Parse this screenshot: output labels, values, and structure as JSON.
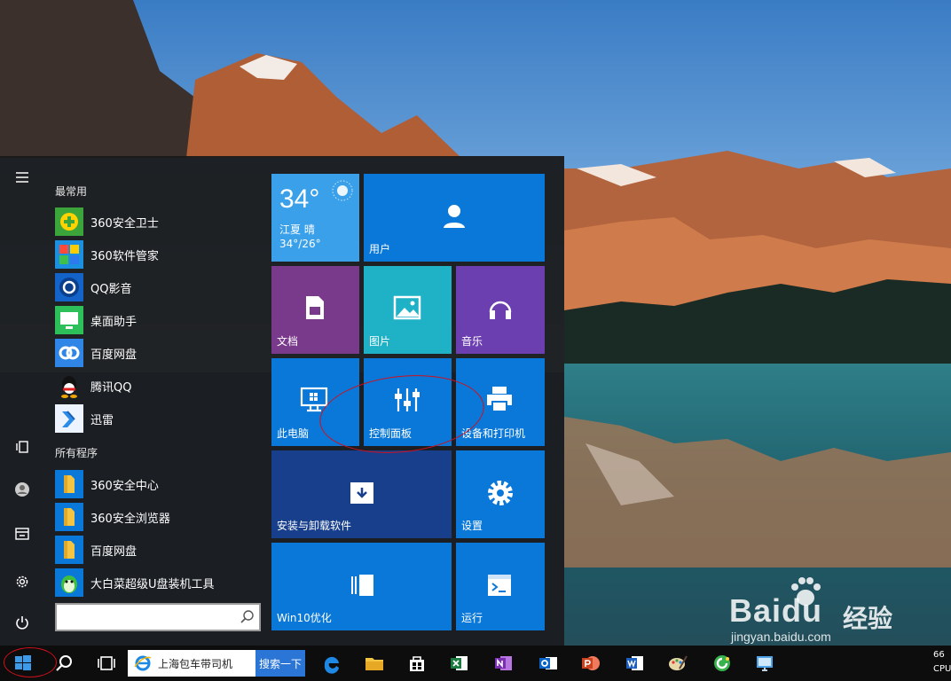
{
  "colors": {
    "tile_blue": "#0a78d8",
    "tile_purple": "#7a3a8c",
    "tile_teal": "#1fb1c6",
    "tile_violet": "#6b3fb0",
    "tile_dark_blue": "#173f8c",
    "start_bg": "#181818",
    "taskbar_bg": "#0d0d0d",
    "annotation_red": "#d0101c"
  },
  "start_menu": {
    "rail": {
      "items": [
        {
          "name": "menu-icon"
        },
        {
          "name": "tablet-mode-icon"
        },
        {
          "name": "user-icon"
        },
        {
          "name": "file-explorer-icon"
        },
        {
          "name": "settings-icon"
        },
        {
          "name": "power-icon"
        }
      ]
    },
    "most_used_label": "最常用",
    "most_used": [
      {
        "label": "360安全卫士",
        "icon": "360-safe-guard-icon"
      },
      {
        "label": "360软件管家",
        "icon": "360-software-manager-icon"
      },
      {
        "label": "QQ影音",
        "icon": "qq-player-icon"
      },
      {
        "label": "桌面助手",
        "icon": "desktop-assistant-icon"
      },
      {
        "label": "百度网盘",
        "icon": "baidu-netdisk-icon"
      },
      {
        "label": "腾讯QQ",
        "icon": "tencent-qq-icon"
      },
      {
        "label": "迅雷",
        "icon": "xunlei-icon"
      }
    ],
    "all_programs_label": "所有程序",
    "all_programs": [
      {
        "label": "360安全中心",
        "icon": "folder-icon"
      },
      {
        "label": "360安全浏览器",
        "icon": "folder-icon"
      },
      {
        "label": "百度网盘",
        "icon": "folder-icon"
      },
      {
        "label": "大白菜超级U盘装机工具",
        "icon": "dabaicai-icon"
      }
    ],
    "search_value": ""
  },
  "tiles": {
    "weather": {
      "temp": "34°",
      "city": "江夏 晴",
      "range": "34°/26°"
    },
    "user": "用户",
    "documents": "文档",
    "pictures": "图片",
    "music": "音乐",
    "this_pc": "此电脑",
    "control_panel": "控制面板",
    "devices_printers": "设备和打印机",
    "install_uninstall": "安装与卸载软件",
    "settings": "设置",
    "win10_optimize": "Win10优化",
    "run": "运行"
  },
  "taskbar": {
    "search_text": "上海包车带司机",
    "search_button": "搜索一下",
    "tray_line1": "66",
    "tray_line2": "CPU"
  },
  "watermark": {
    "brand": "Baidu",
    "brand_cn": "经验",
    "url": "jingyan.baidu.com"
  }
}
